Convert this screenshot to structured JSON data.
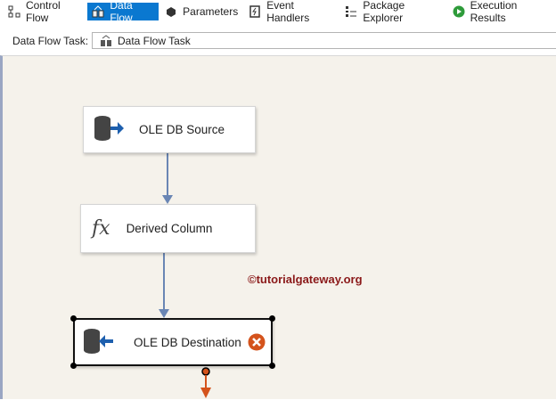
{
  "tabs": [
    {
      "label": "Control Flow",
      "icon": "control-flow-icon"
    },
    {
      "label": "Data Flow",
      "icon": "data-flow-icon",
      "active": true
    },
    {
      "label": "Parameters",
      "icon": "parameters-icon"
    },
    {
      "label": "Event Handlers",
      "icon": "event-handlers-icon"
    },
    {
      "label": "Package Explorer",
      "icon": "package-explorer-icon"
    },
    {
      "label": "Execution Results",
      "icon": "execution-results-icon"
    }
  ],
  "task": {
    "label": "Data Flow Task:",
    "value": "Data Flow Task"
  },
  "nodes": {
    "source": "OLE DB Source",
    "derived": "Derived Column",
    "destination": "OLE DB Destination"
  },
  "watermark": "©tutorialgateway.org",
  "colors": {
    "accent": "#0a78d0",
    "error": "#d4531c",
    "arrow": "#6a86b4",
    "watermark": "#8b1a1a"
  }
}
